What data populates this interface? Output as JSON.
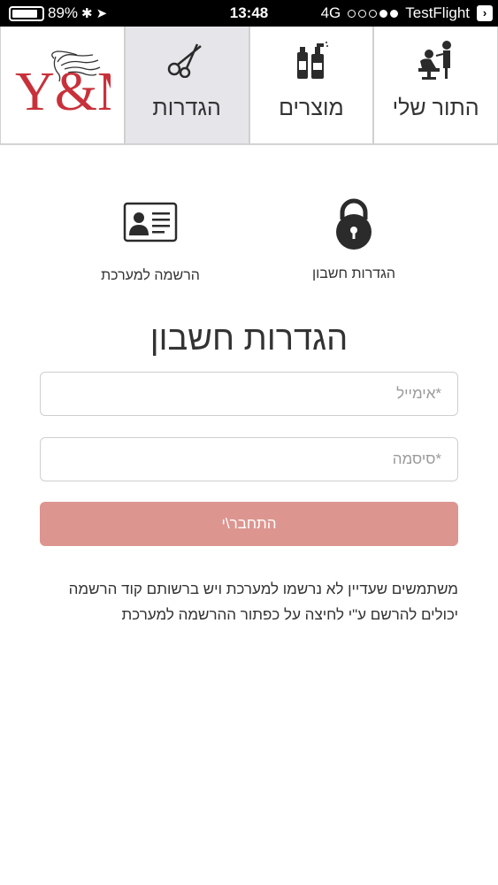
{
  "status_bar": {
    "battery": "89%",
    "battery_level": 0.89,
    "time": "13:48",
    "network": "4G",
    "carrier": "TestFlight"
  },
  "nav": {
    "tabs": [
      {
        "label": "התור שלי",
        "icon": "barber-chair-icon"
      },
      {
        "label": "מוצרים",
        "icon": "products-icon"
      },
      {
        "label": "הגדרות",
        "icon": "scissors-icon",
        "active": true
      }
    ],
    "logo_text": "Y&M"
  },
  "options": {
    "account_settings": {
      "label": "הגדרות חשבון",
      "icon": "lock-icon"
    },
    "register": {
      "label": "הרשמה למערכת",
      "icon": "id-card-icon"
    }
  },
  "form": {
    "title": "הגדרות חשבון",
    "email_placeholder": "*אימייל",
    "password_placeholder": "*סיסמה",
    "login_label": "התחבר\\י"
  },
  "info_text": "משתמשים שעדיין לא נרשמו למערכת ויש ברשותם קוד הרשמה יכולים להרשם ע\"י לחיצה על כפתור ההרשמה למערכת",
  "colors": {
    "login_button": "#dd9590",
    "logo_red": "#c8313a",
    "active_tab": "#e6e6ea"
  }
}
